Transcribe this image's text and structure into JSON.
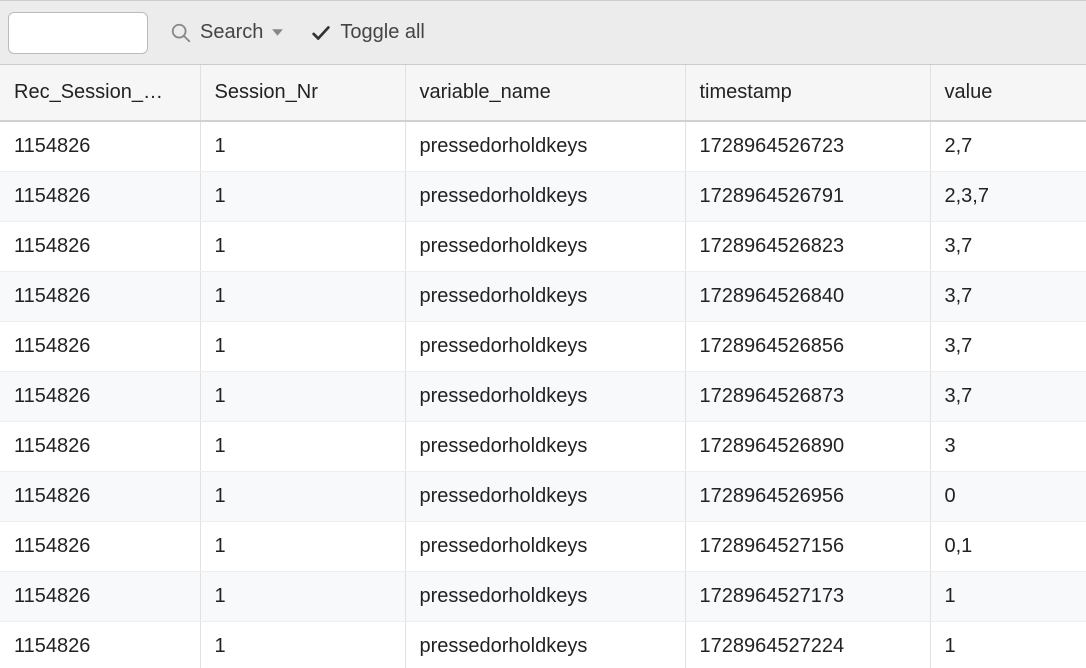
{
  "toolbar": {
    "search_value": "",
    "search_button_label": "Search",
    "toggle_all_label": "Toggle all"
  },
  "table": {
    "columns": [
      "Rec_Session_…",
      "Session_Nr",
      "variable_name",
      "timestamp",
      "value"
    ],
    "rows": [
      {
        "rec_session": "1154826",
        "session_nr": "1",
        "variable_name": "pressedorholdkeys",
        "timestamp": "1728964526723",
        "value": "2,7"
      },
      {
        "rec_session": "1154826",
        "session_nr": "1",
        "variable_name": "pressedorholdkeys",
        "timestamp": "1728964526791",
        "value": "2,3,7"
      },
      {
        "rec_session": "1154826",
        "session_nr": "1",
        "variable_name": "pressedorholdkeys",
        "timestamp": "1728964526823",
        "value": "3,7"
      },
      {
        "rec_session": "1154826",
        "session_nr": "1",
        "variable_name": "pressedorholdkeys",
        "timestamp": "1728964526840",
        "value": "3,7"
      },
      {
        "rec_session": "1154826",
        "session_nr": "1",
        "variable_name": "pressedorholdkeys",
        "timestamp": "1728964526856",
        "value": "3,7"
      },
      {
        "rec_session": "1154826",
        "session_nr": "1",
        "variable_name": "pressedorholdkeys",
        "timestamp": "1728964526873",
        "value": "3,7"
      },
      {
        "rec_session": "1154826",
        "session_nr": "1",
        "variable_name": "pressedorholdkeys",
        "timestamp": "1728964526890",
        "value": "3"
      },
      {
        "rec_session": "1154826",
        "session_nr": "1",
        "variable_name": "pressedorholdkeys",
        "timestamp": "1728964526956",
        "value": "0"
      },
      {
        "rec_session": "1154826",
        "session_nr": "1",
        "variable_name": "pressedorholdkeys",
        "timestamp": "1728964527156",
        "value": "0,1"
      },
      {
        "rec_session": "1154826",
        "session_nr": "1",
        "variable_name": "pressedorholdkeys",
        "timestamp": "1728964527173",
        "value": "1"
      },
      {
        "rec_session": "1154826",
        "session_nr": "1",
        "variable_name": "pressedorholdkeys",
        "timestamp": "1728964527224",
        "value": "1"
      }
    ]
  }
}
